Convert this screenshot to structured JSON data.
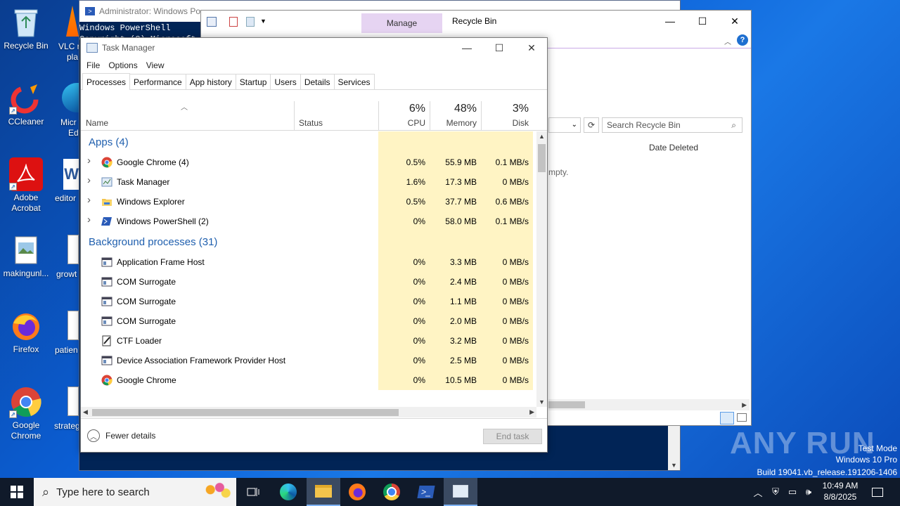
{
  "desktop": {
    "icons": [
      {
        "label": "Recycle Bin",
        "icon": "recycle-bin-icon"
      },
      {
        "label": "CCleaner",
        "icon": "ccleaner-icon"
      },
      {
        "label": "Adobe Acrobat",
        "icon": "acrobat-icon"
      },
      {
        "label": "makingunl...",
        "icon": "image-file-icon"
      },
      {
        "label": "Firefox",
        "icon": "firefox-icon"
      },
      {
        "label": "Google Chrome",
        "icon": "chrome-icon"
      }
    ],
    "peek_labels": [
      "VLC r",
      "pla",
      "Micr",
      "Ed",
      "editor",
      "growt",
      "patien",
      "strateg"
    ]
  },
  "powershell": {
    "title": "Administrator: Windows Po",
    "line1": "Windows PowerShell",
    "line2": "Copyright (C) Microsoft C"
  },
  "explorer": {
    "manage_tab": "Manage",
    "title": "Recycle Bin",
    "search_placeholder": "Search Recycle Bin",
    "column_date_deleted": "Date Deleted",
    "empty_text": "mpty."
  },
  "taskmanager": {
    "title": "Task Manager",
    "menu": [
      "File",
      "Options",
      "View"
    ],
    "tabs": [
      "Processes",
      "Performance",
      "App history",
      "Startup",
      "Users",
      "Details",
      "Services"
    ],
    "active_tab": "Processes",
    "columns": {
      "name": "Name",
      "status": "Status",
      "cpu": {
        "pct": "6%",
        "label": "CPU"
      },
      "memory": {
        "pct": "48%",
        "label": "Memory"
      },
      "disk": {
        "pct": "3%",
        "label": "Disk"
      }
    },
    "groups": [
      {
        "title": "Apps (4)",
        "rows": [
          {
            "name": "Google Chrome (4)",
            "icon": "chrome-icon",
            "expandable": true,
            "cpu": "0.5%",
            "memory": "55.9 MB",
            "disk": "0.1 MB/s"
          },
          {
            "name": "Task Manager",
            "icon": "task-manager-icon",
            "expandable": true,
            "cpu": "1.6%",
            "memory": "17.3 MB",
            "disk": "0 MB/s"
          },
          {
            "name": "Windows Explorer",
            "icon": "folder-icon",
            "expandable": true,
            "cpu": "0.5%",
            "memory": "37.7 MB",
            "disk": "0.6 MB/s"
          },
          {
            "name": "Windows PowerShell (2)",
            "icon": "powershell-icon",
            "expandable": true,
            "cpu": "0%",
            "memory": "58.0 MB",
            "disk": "0.1 MB/s"
          }
        ]
      },
      {
        "title": "Background processes (31)",
        "rows": [
          {
            "name": "Application Frame Host",
            "icon": "app-window-icon",
            "expandable": false,
            "cpu": "0%",
            "memory": "3.3 MB",
            "disk": "0 MB/s"
          },
          {
            "name": "COM Surrogate",
            "icon": "app-window-icon",
            "expandable": false,
            "cpu": "0%",
            "memory": "2.4 MB",
            "disk": "0 MB/s"
          },
          {
            "name": "COM Surrogate",
            "icon": "app-window-icon",
            "expandable": false,
            "cpu": "0%",
            "memory": "1.1 MB",
            "disk": "0 MB/s"
          },
          {
            "name": "COM Surrogate",
            "icon": "app-window-icon",
            "expandable": false,
            "cpu": "0%",
            "memory": "2.0 MB",
            "disk": "0 MB/s"
          },
          {
            "name": "CTF Loader",
            "icon": "ctf-loader-icon",
            "expandable": false,
            "cpu": "0%",
            "memory": "3.2 MB",
            "disk": "0 MB/s"
          },
          {
            "name": "Device Association Framework Provider Host",
            "icon": "app-window-icon",
            "expandable": false,
            "cpu": "0%",
            "memory": "2.5 MB",
            "disk": "0 MB/s"
          },
          {
            "name": "Google Chrome",
            "icon": "chrome-icon",
            "expandable": false,
            "cpu": "0%",
            "memory": "10.5 MB",
            "disk": "0 MB/s"
          }
        ]
      }
    ],
    "footer": {
      "fewer_details": "Fewer details",
      "end_task": "End task"
    }
  },
  "watermark": {
    "brand": "ANY RUN",
    "lines": [
      "Test Mode",
      "Windows 10 Pro",
      "Build 19041.vb_release.191206-1406"
    ]
  },
  "taskbar": {
    "search_placeholder": "Type here to search",
    "time": "10:49 AM",
    "date": "8/8/2025"
  },
  "colors": {
    "desktop": "#0b5fd6",
    "highlight_cell": "#fff4c4",
    "group_title": "#1f5fae",
    "manage_tab": "#e6d4f2"
  }
}
